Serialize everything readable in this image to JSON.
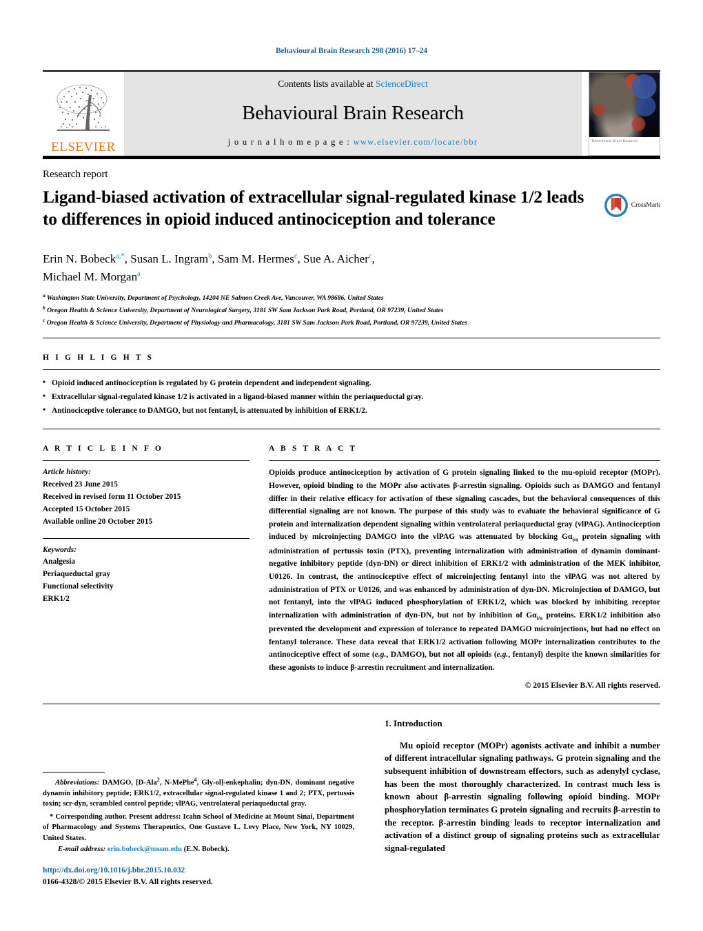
{
  "running_head": "Behavioural Brain Research 298 (2016) 17–24",
  "masthead": {
    "publisher": "ELSEVIER",
    "contents_prefix": "Contents lists available at ",
    "contents_link": "ScienceDirect",
    "journal_title": "Behavioural Brain Research",
    "homepage_prefix": "j o u r n a l   h o m e p a g e :  ",
    "homepage_url": "www.elsevier.com/locate/bbr",
    "cover_caption": "Behavioural Brain Research"
  },
  "article": {
    "kind": "Research report",
    "title": "Ligand-biased activation of extracellular signal-regulated kinase 1/2 leads to differences in opioid induced antinociception and tolerance",
    "crossmark_label": "CrossMark",
    "authors_line1": "Erin N. Bobeck",
    "authors_line1_marks": "a,*",
    "authors_rest": ", Susan L. Ingram",
    "author2_mark": "b",
    "author3": ", Sam M. Hermes",
    "author3_mark": "c",
    "author4": ", Sue A. Aicher",
    "author4_mark": "c",
    "author5": "Michael M. Morgan",
    "author5_mark": "a",
    "affiliations": [
      {
        "mark": "a",
        "text": "Washington State University, Department of Psychology, 14204 NE Salmon Creek Ave, Vancouver, WA 98686, United States"
      },
      {
        "mark": "b",
        "text": "Oregon Health & Science University, Department of Neurological Surgery, 3181 SW Sam Jackson Park Road, Portland, OR 97239, United States"
      },
      {
        "mark": "c",
        "text": "Oregon Health & Science University, Department of Physiology and Pharmacology, 3181 SW Sam Jackson Park Road, Portland, OR 97239, United States"
      }
    ]
  },
  "highlights": {
    "heading": "H I G H L I G H T S",
    "items": [
      "Opioid induced antinociception is regulated by G protein dependent and independent signaling.",
      "Extracellular signal-regulated kinase 1/2 is activated in a ligand-biased manner within the periaqueductal gray.",
      "Antinociceptive tolerance to DAMGO, but not fentanyl, is attenuated by inhibition of ERK1/2."
    ]
  },
  "article_info": {
    "heading": "A R T I C L E    I N F O",
    "history_label": "Article history:",
    "history": [
      "Received 23 June 2015",
      "Received in revised form 11 October 2015",
      "Accepted 15 October 2015",
      "Available online 20 October 2015"
    ],
    "keywords_label": "Keywords:",
    "keywords": [
      "Analgesia",
      "Periaqueductal gray",
      "Functional selectivity",
      "ERK1/2"
    ]
  },
  "abstract": {
    "heading": "A B S T R A C T",
    "p1_a": "Opioids produce antinociception by activation of G protein signaling linked to the mu-opioid receptor (MOPr). However, opioid binding to the MOPr also activates β-arrestin signaling. Opioids such as DAMGO and fentanyl differ in their relative efficacy for activation of these signaling cascades, but the behavioral consequences of this differential signaling are not known. The purpose of this study was to evaluate the behavioral significance of G protein and internalization dependent signaling within ventrolateral periaqueductal gray (vlPAG). Antinociception induced by microinjecting DAMGO into the vlPAG was attenuated by blocking Gα",
    "sub1": "i/o",
    "p1_b": " protein signaling with administration of pertussis toxin (PTX), preventing internalization with administration of dynamin dominant-negative inhibitory peptide (dyn-DN) or direct inhibition of ERK1/2 with administration of the MEK inhibitor, U0126. In contrast, the antinociceptive effect of microinjecting fentanyl into the vlPAG was not altered by administration of PTX or U0126, and was enhanced by administration of dyn-DN. Microinjection of DAMGO, but not fentanyl, into the vlPAG induced phosphorylation of ERK1/2, which was blocked by inhibiting receptor internalization with administration of dyn-DN, but not by inhibition of Gα",
    "sub2": "i/o",
    "p1_c": " proteins. ERK1/2 inhibition also prevented the development and expression of tolerance to repeated DAMGO microinjections, but had no effect on fentanyl tolerance. These data reveal that ERK1/2 activation following MOPr internalization contributes to the antinociceptive effect of some (",
    "eg1": "e.g.",
    "p1_d": ", DAMGO), but not all opioids (",
    "eg2": "e.g.",
    "p1_e": ", fentanyl) despite the known similarities for these agonists to induce β-arrestin recruitment and internalization.",
    "copyright": "© 2015 Elsevier B.V. All rights reserved."
  },
  "introduction": {
    "heading": "1.  Introduction",
    "paragraph": "Mu opioid receptor (MOPr) agonists activate and inhibit a number of different intracellular signaling pathways. G protein signaling and the subsequent inhibition of downstream effectors, such as adenylyl cyclase, has been the most thoroughly characterized. In contrast much less is known about β-arrestin signaling following opioid binding. MOPr phosphorylation terminates G protein signaling and recruits β-arrestin to the receptor. β-arrestin binding leads to receptor internalization and activation of a distinct group of signaling proteins such as extracellular signal-regulated"
  },
  "footnotes": {
    "abbrev_label": "Abbreviations:",
    "abbrev_a": "  DAMGO, [D-Ala",
    "abbrev_sup1": "2",
    "abbrev_b": ", N-MePhe",
    "abbrev_sup2": "4",
    "abbrev_c": ", Gly-ol]-enkephalin; dyn-DN, dominant negative dynamin inhibitory peptide; ERK1/2, extracellular signal-regulated kinase 1 and 2; PTX, pertussis toxin; scr-dyn, scrambled control peptide; vlPAG, ventrolateral periaqueductal gray.",
    "corresponding": "* Corresponding author. Present address: Icahn School of Medicine at Mount Sinai, Department of Pharmacology and Systems Therapeutics, One Gustave L. Levy Place, New York, NY 10029, United States.",
    "email_label": "E-mail address:",
    "email": "erin.bobeck@mssm.edu",
    "email_suffix": " (E.N. Bobeck)."
  },
  "doi": {
    "url": "http://dx.doi.org/10.1016/j.bbr.2015.10.032",
    "issn_line": "0166-4328/© 2015 Elsevier B.V. All rights reserved."
  },
  "colors": {
    "link": "#1a7fbf",
    "elsevier_orange": "#E87722",
    "masthead_bg": "#e4e4e4"
  }
}
